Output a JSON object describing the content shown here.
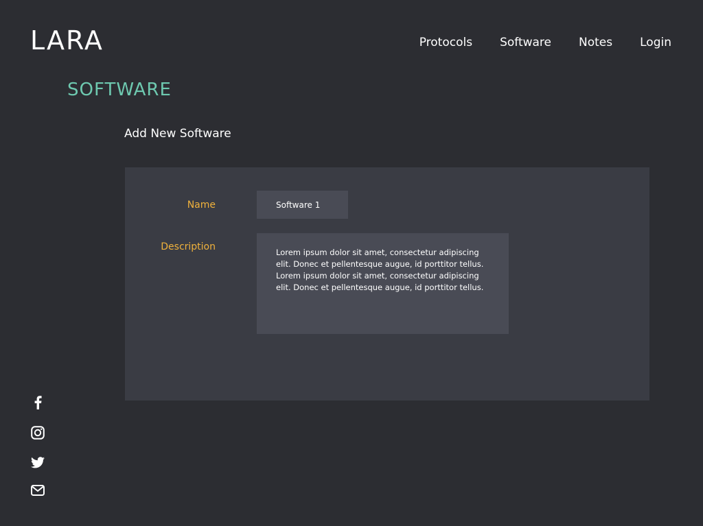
{
  "brand": {
    "logo": "LARA"
  },
  "nav": {
    "items": [
      {
        "label": "Protocols"
      },
      {
        "label": "Software"
      },
      {
        "label": "Notes"
      },
      {
        "label": "Login"
      }
    ]
  },
  "page": {
    "title": "SOFTWARE",
    "section_heading": "Add New Software"
  },
  "form": {
    "name_label": "Name",
    "name_value": "Software 1",
    "description_label": "Description",
    "description_value": "Lorem ipsum dolor sit amet, consectetur adipiscing elit. Donec et pellentesque augue, id porttitor tellus. Lorem ipsum dolor sit amet, consectetur adipiscing elit. Donec et pellentesque augue, id porttitor tellus."
  },
  "social": {
    "icons": [
      "facebook-icon",
      "instagram-icon",
      "twitter-icon",
      "mail-icon"
    ]
  },
  "colors": {
    "background": "#2c2d32",
    "panel": "#3a3c44",
    "input": "#494b55",
    "accent_title": "#6ec9b0",
    "accent_label": "#f0b23c",
    "text": "#ffffff"
  }
}
